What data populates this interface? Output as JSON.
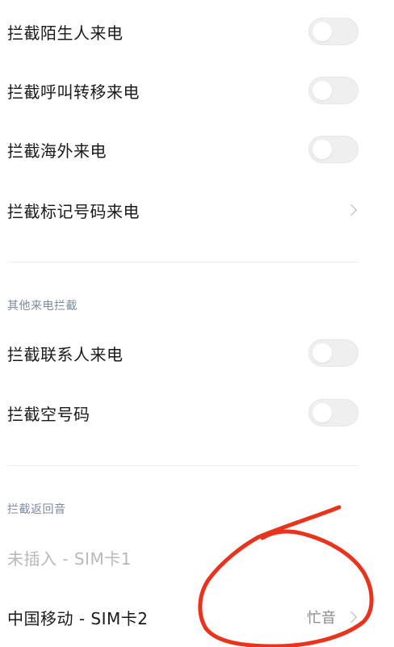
{
  "settings": {
    "block_strangers": {
      "label": "拦截陌生人来电",
      "enabled": false
    },
    "block_forwarded": {
      "label": "拦截呼叫转移来电",
      "enabled": false
    },
    "block_overseas": {
      "label": "拦截海外来电",
      "enabled": false
    },
    "block_marked": {
      "label": "拦截标记号码来电"
    }
  },
  "other_section": {
    "header": "其他来电拦截",
    "block_contacts": {
      "label": "拦截联系人来电",
      "enabled": false
    },
    "block_empty_numbers": {
      "label": "拦截空号码",
      "enabled": false
    }
  },
  "return_tone_section": {
    "header": "拦截返回音",
    "sim1": {
      "label": "未插入 - SIM卡1"
    },
    "sim2": {
      "label": "中国移动 - SIM卡2",
      "value": "忙音"
    }
  },
  "colors": {
    "annotation_circle": "#e8341c",
    "section_header": "#7d8b9a",
    "disabled_text": "#b9b9b9"
  }
}
